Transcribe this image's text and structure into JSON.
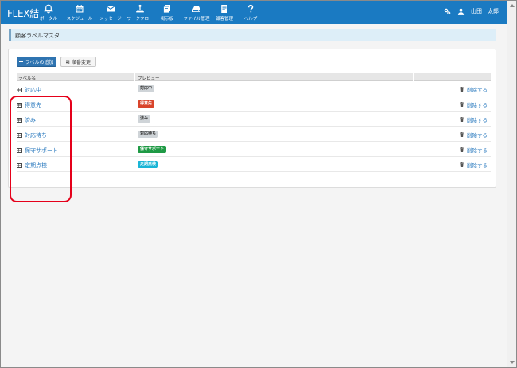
{
  "app": {
    "logo": "FLEX結",
    "user_name": "山田　太郎"
  },
  "nav": [
    {
      "label": "ポータル",
      "icon": "bell-icon"
    },
    {
      "label": "スケジュール",
      "icon": "calendar-icon"
    },
    {
      "label": "メッセージ",
      "icon": "envelope-icon"
    },
    {
      "label": "ワークフロー",
      "icon": "workflow-icon"
    },
    {
      "label": "掲示板",
      "icon": "board-icon"
    },
    {
      "label": "ファイル管理",
      "icon": "hdd-icon"
    },
    {
      "label": "顧客管理",
      "icon": "customer-icon"
    },
    {
      "label": "ヘルプ",
      "icon": "question-icon"
    }
  ],
  "page": {
    "title": "顧客ラベルマスタ",
    "add_button": "ラベルの追加",
    "sort_button": "順番変更"
  },
  "table": {
    "columns": [
      "ラベル名",
      "プレビュー"
    ],
    "delete_label": "削除する",
    "rows": [
      {
        "name": "対応中",
        "preview": "対応中",
        "bg": "#cfd4d8",
        "fg": "#333333"
      },
      {
        "name": "得意先",
        "preview": "得意先",
        "bg": "#d9442b",
        "fg": "#ffffff"
      },
      {
        "name": "済み",
        "preview": "済み",
        "bg": "#cfd4d8",
        "fg": "#333333"
      },
      {
        "name": "対応待ち",
        "preview": "対応待ち",
        "bg": "#cfd4d8",
        "fg": "#333333"
      },
      {
        "name": "保守サポート",
        "preview": "保守サポート",
        "bg": "#1f9a45",
        "fg": "#ffffff"
      },
      {
        "name": "定期点検",
        "preview": "定期点検",
        "bg": "#19b5d6",
        "fg": "#ffffff"
      }
    ]
  },
  "colors": {
    "header": "#1a7ac2",
    "link": "#2c7bbf",
    "primary_button": "#2f74b1",
    "annotation": "#e5001a"
  }
}
